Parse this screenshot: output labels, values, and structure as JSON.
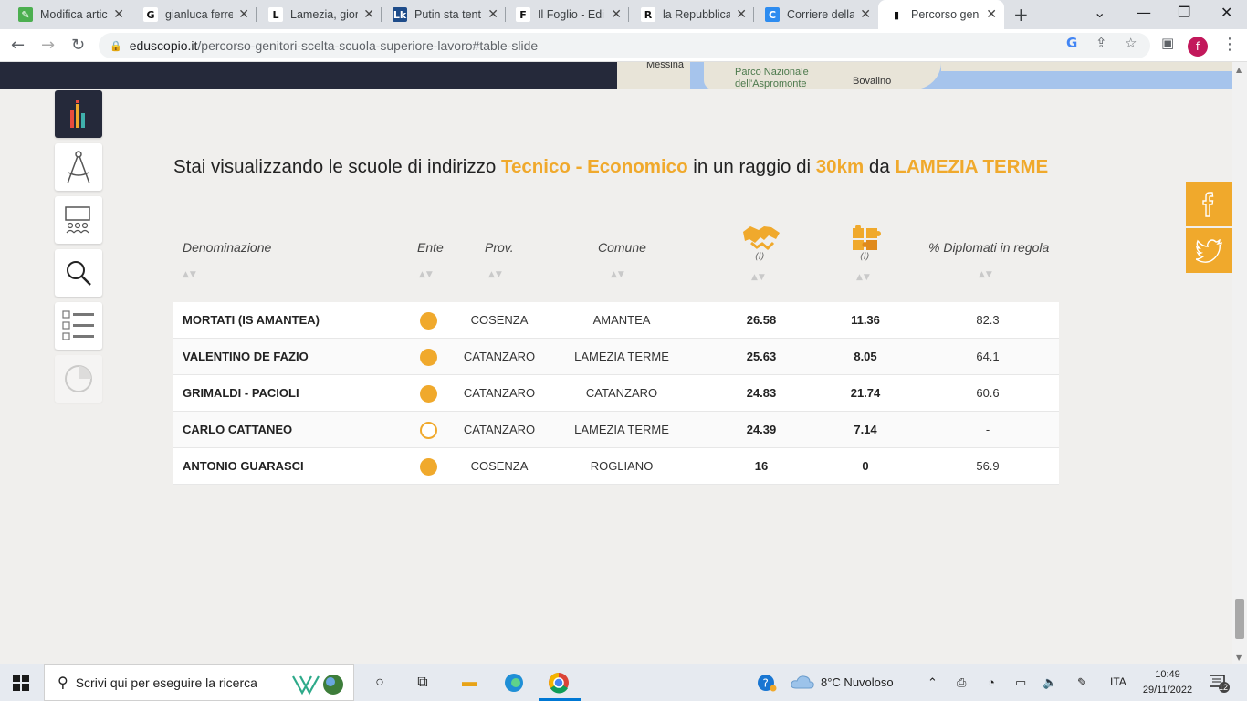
{
  "browser": {
    "tabs": [
      {
        "title": "Modifica artic",
        "favicon": "#4caf50",
        "glyph": "✎"
      },
      {
        "title": "gianluca ferre",
        "favicon": "#ffffff",
        "glyph": "G"
      },
      {
        "title": "Lamezia, gior",
        "favicon": "#ffffff",
        "glyph": "L"
      },
      {
        "title": "Putin sta tent",
        "favicon": "#1e4c8a",
        "glyph": "Lk"
      },
      {
        "title": "Il Foglio - Edi",
        "favicon": "#ffffff",
        "glyph": "F"
      },
      {
        "title": "la Repubblica",
        "favicon": "#ffffff",
        "glyph": "R"
      },
      {
        "title": "Corriere della",
        "favicon": "#2d8cf0",
        "glyph": "C"
      },
      {
        "title": "Percorso geni",
        "favicon": "#ffffff",
        "glyph": "▮"
      }
    ],
    "active_tab_index": 7,
    "url_domain": "eduscopio.it",
    "url_path": "/percorso-genitori-scelta-scuola-superiore-lavoro#table-slide",
    "avatar_letter": "f"
  },
  "map": {
    "labels": [
      "Messina",
      "Parco Nazionale",
      "dell'Aspromonte",
      "Bovalino"
    ]
  },
  "heading": {
    "prefix": "Stai visualizzando le scuole di indirizzo ",
    "indirizzo": "Tecnico - Economico",
    "middle": " in un raggio di ",
    "raggio": "30km",
    "da": " da ",
    "citta": "LAMEZIA TERME"
  },
  "table": {
    "headers": {
      "denominazione": "Denominazione",
      "ente": "Ente",
      "prov": "Prov.",
      "comune": "Comune",
      "info1": "(i)",
      "info2": "(i)",
      "diplomati": "% Diplomati in regola"
    },
    "rows": [
      {
        "nome": "MORTATI (IS AMANTEA)",
        "ente": "full",
        "prov": "COSENZA",
        "comune": "AMANTEA",
        "v1": "26.58",
        "v2": "11.36",
        "pct": "82.3"
      },
      {
        "nome": "VALENTINO DE FAZIO",
        "ente": "full",
        "prov": "CATANZARO",
        "comune": "LAMEZIA TERME",
        "v1": "25.63",
        "v2": "8.05",
        "pct": "64.1"
      },
      {
        "nome": "GRIMALDI - PACIOLI",
        "ente": "full",
        "prov": "CATANZARO",
        "comune": "CATANZARO",
        "v1": "24.83",
        "v2": "21.74",
        "pct": "60.6"
      },
      {
        "nome": "CARLO CATTANEO",
        "ente": "empty",
        "prov": "CATANZARO",
        "comune": "LAMEZIA TERME",
        "v1": "24.39",
        "v2": "7.14",
        "pct": "-"
      },
      {
        "nome": "ANTONIO GUARASCI",
        "ente": "full",
        "prov": "COSENZA",
        "comune": "ROGLIANO",
        "v1": "16",
        "v2": "0",
        "pct": "56.9"
      }
    ]
  },
  "colors": {
    "accent": "#f0a92c",
    "dark": "#25293a"
  },
  "taskbar": {
    "search_placeholder": "Scrivi qui per eseguire la ricerca",
    "weather": "8°C  Nuvoloso",
    "language": "ITA",
    "time": "10:49",
    "date": "29/11/2022",
    "notifications": "12"
  }
}
